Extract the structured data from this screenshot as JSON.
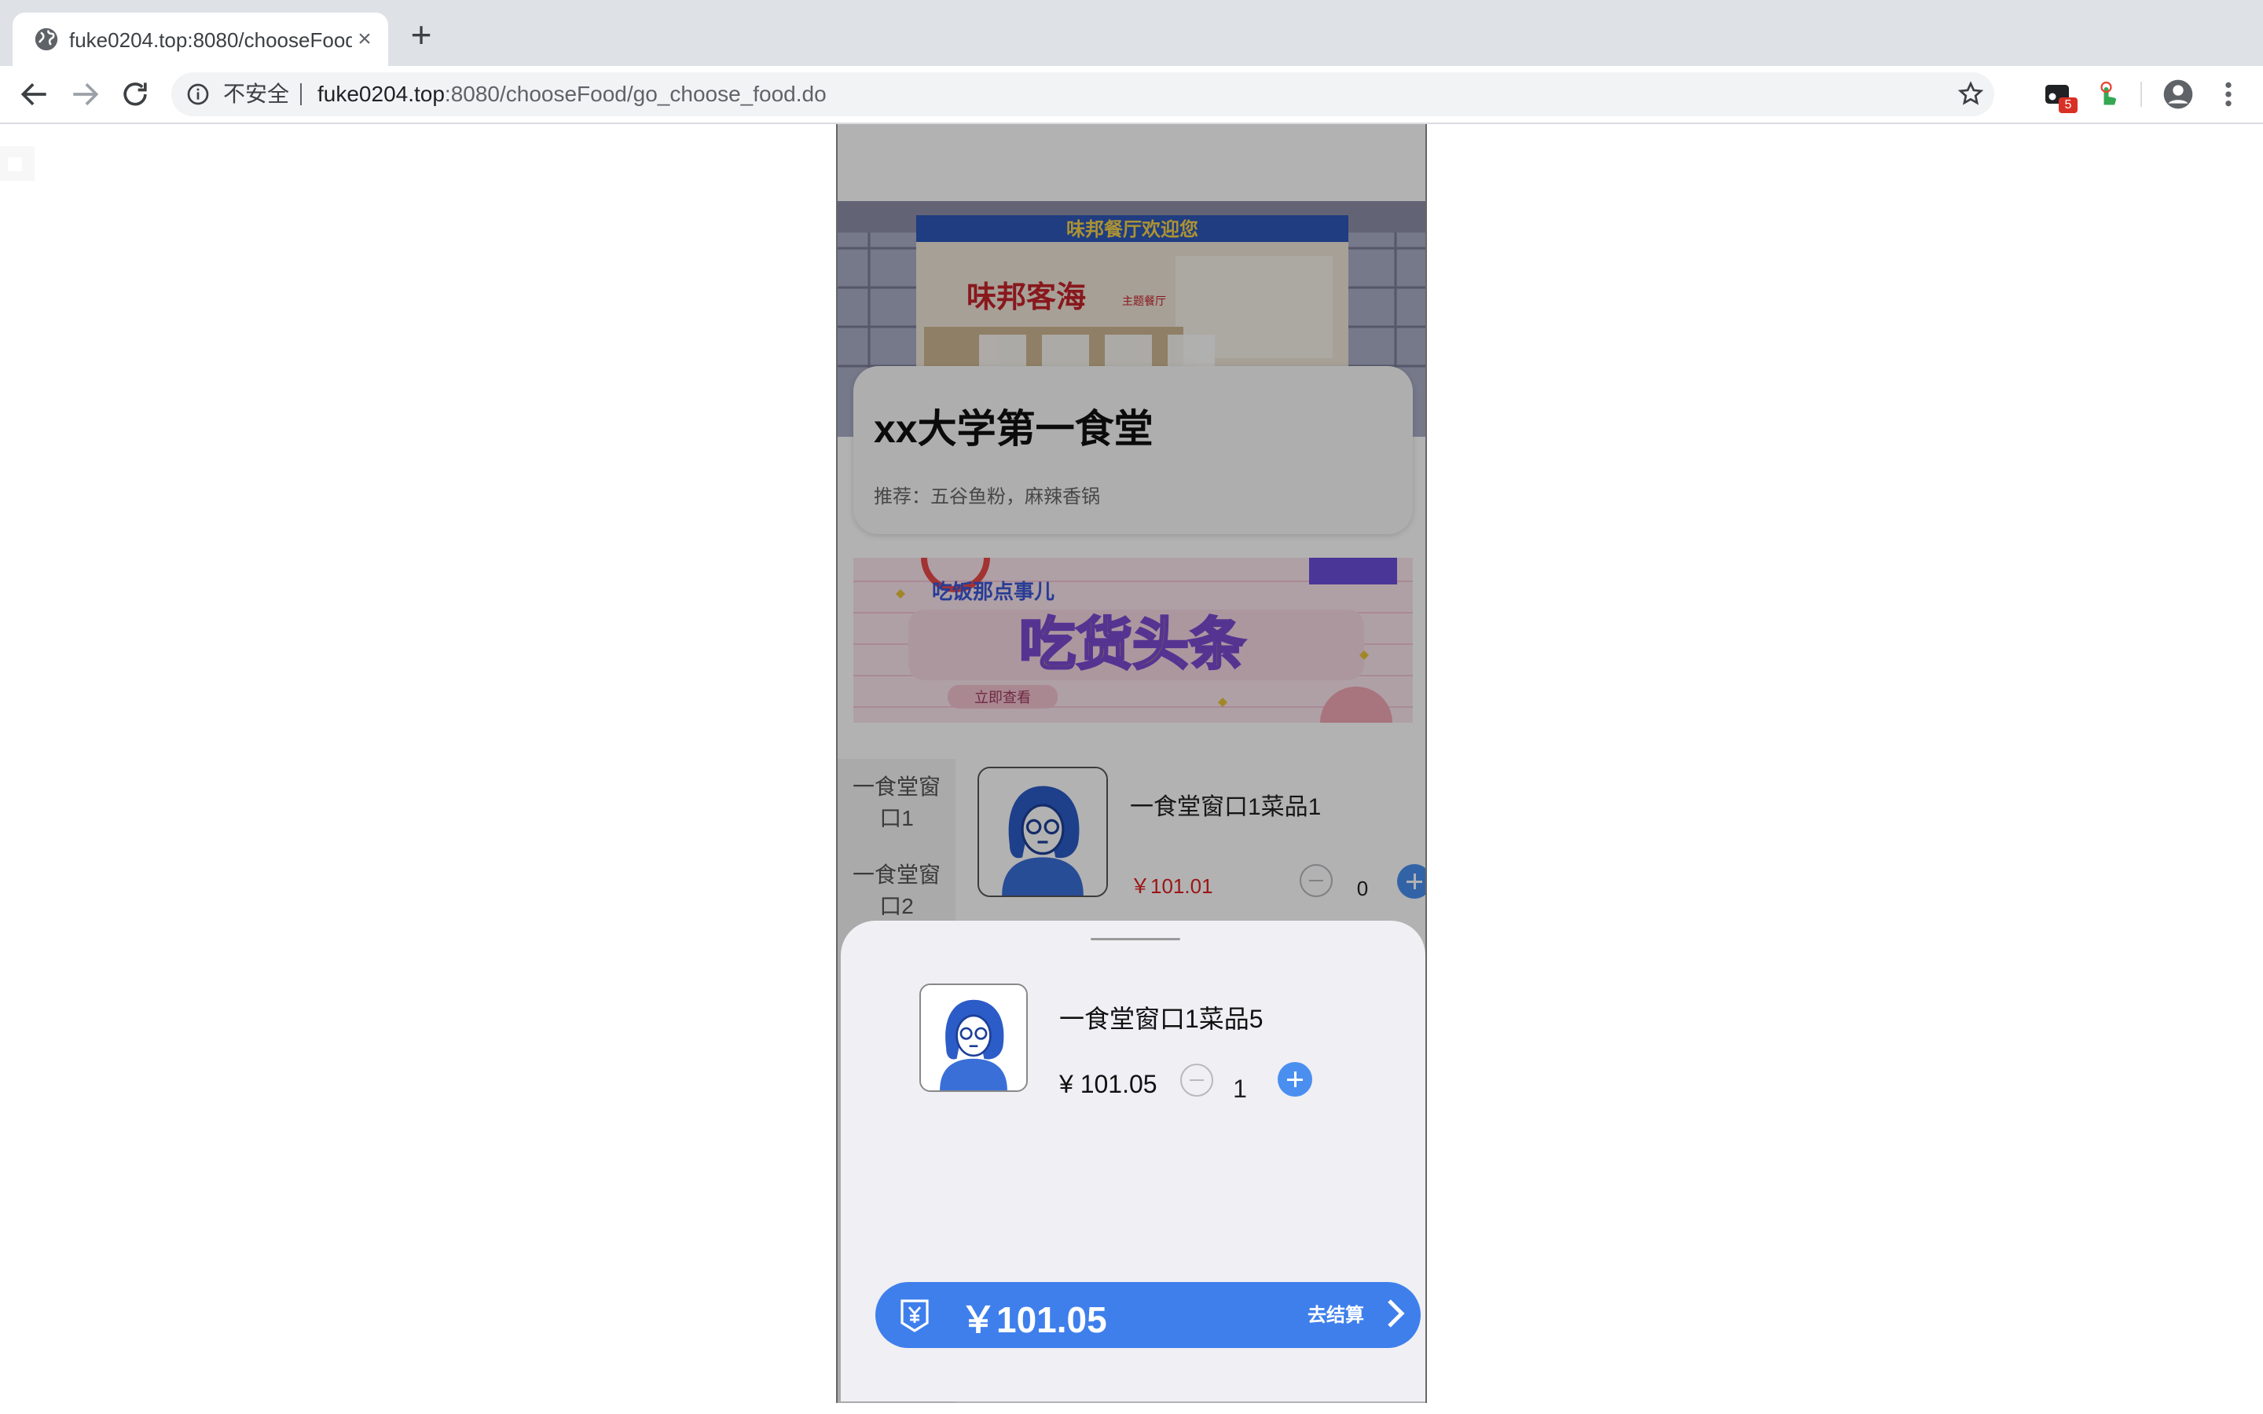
{
  "browser": {
    "tab_title": "fuke0204.top:8080/chooseFood/go_choose_food.do",
    "security_label": "不安全",
    "url_host": "fuke0204.top",
    "url_rest": ":8080/chooseFood/go_choose_food.do",
    "extension_badge": "5"
  },
  "canteen": {
    "title": "xx大学第一食堂",
    "recommend": "推荐：五谷鱼粉，麻辣香锅",
    "hero_signs": [
      "味邦餐厅欢迎您",
      "味邦客海",
      "主题餐厅"
    ],
    "banner_texts": [
      "吃饭那点事儿",
      "吃货头条",
      "立即查看"
    ]
  },
  "categories": [
    {
      "line1": "一食堂窗",
      "line2": "口1"
    },
    {
      "line1": "一食堂窗",
      "line2": "口2"
    }
  ],
  "dishes": [
    {
      "name": "一食堂窗口1菜品1",
      "price": "￥101.01",
      "qty": "0"
    }
  ],
  "cart": {
    "items": [
      {
        "name": "一食堂窗口1菜品5",
        "price": "¥ 101.05",
        "qty": "1"
      }
    ],
    "total": "￥101.05",
    "checkout_label": "去结算"
  },
  "colors": {
    "accent": "#3f7fec",
    "plus_button": "#4a8ff0",
    "price_red": "#e02020"
  }
}
